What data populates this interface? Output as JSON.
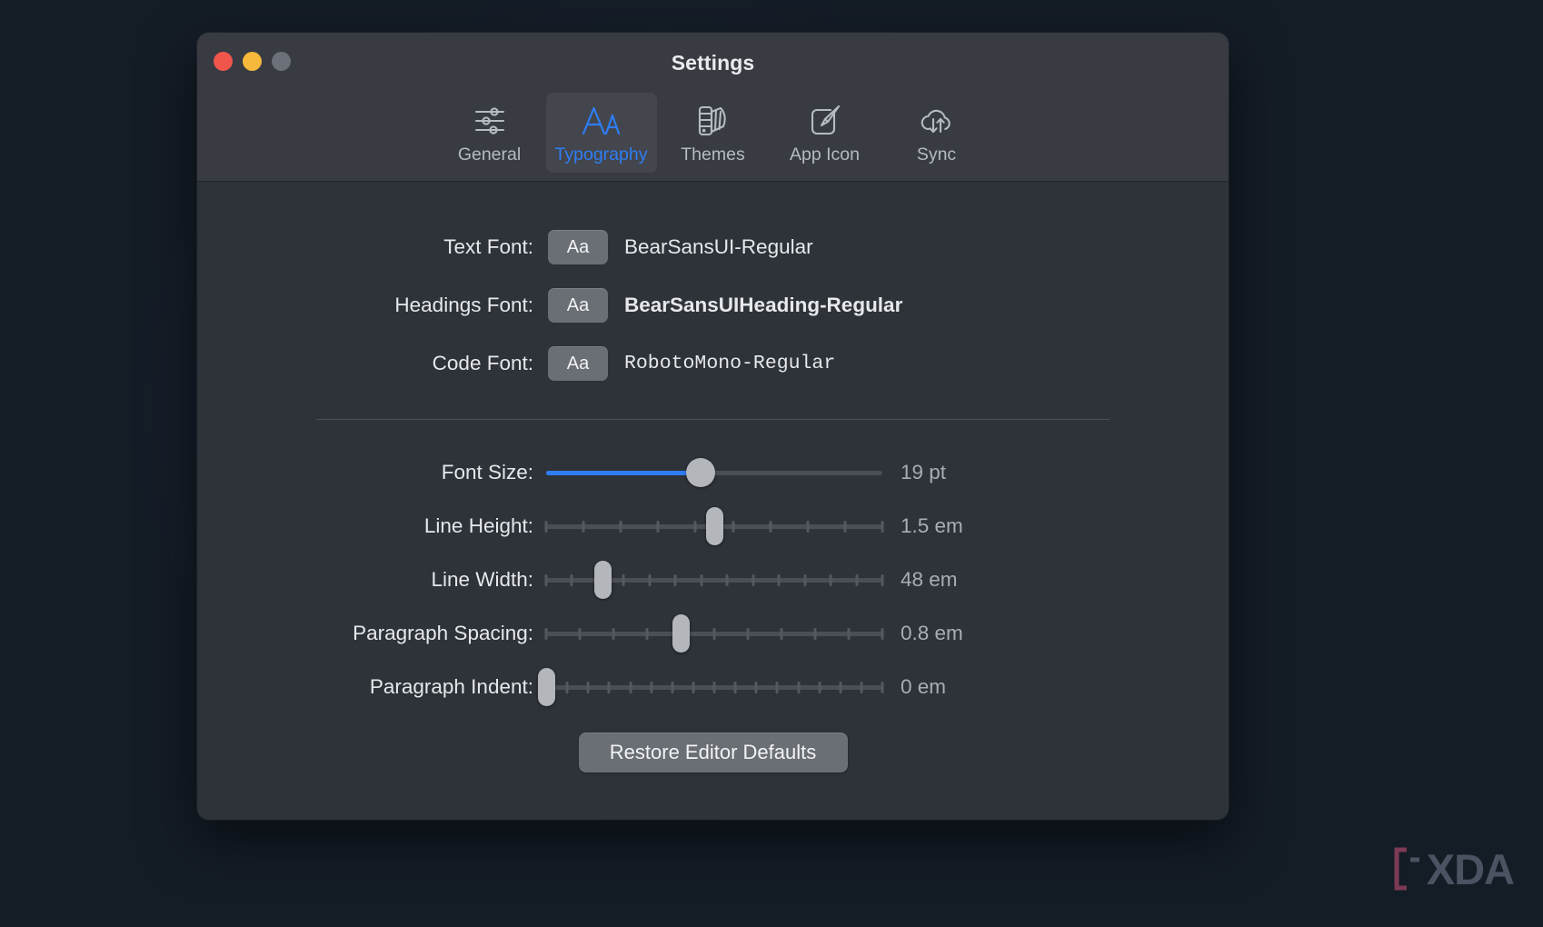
{
  "window": {
    "title": "Settings",
    "traffic_lights": [
      {
        "name": "close",
        "color": "#f1564c"
      },
      {
        "name": "minimize",
        "color": "#f6b93b"
      },
      {
        "name": "maximize",
        "color": "#6c7078"
      }
    ]
  },
  "toolbar": {
    "active": "Typography",
    "accent": "#2e7df6",
    "items": [
      {
        "label": "General",
        "icon": "sliders-icon",
        "active": false
      },
      {
        "label": "Typography",
        "icon": "font-size-icon",
        "active": true
      },
      {
        "label": "Themes",
        "icon": "swatch-fan-icon",
        "active": false
      },
      {
        "label": "App Icon",
        "icon": "paintbrush-icon",
        "active": false
      },
      {
        "label": "Sync",
        "icon": "cloud-sync-icon",
        "active": false
      }
    ]
  },
  "fonts": {
    "button_label": "Aa",
    "rows": [
      {
        "label": "Text Font:",
        "value": "BearSansUI-Regular",
        "style": "regular"
      },
      {
        "label": "Headings Font:",
        "value": "BearSansUIHeading-Regular",
        "style": "bold"
      },
      {
        "label": "Code Font:",
        "value": "RobotoMono-Regular",
        "style": "mono"
      }
    ]
  },
  "sliders": [
    {
      "label": "Font Size:",
      "value_text": "19 pt",
      "value": 19,
      "unit": "pt",
      "kind": "continuous",
      "percent": 46,
      "ticks": 0,
      "filled": true,
      "fill_color": "#2e7df6"
    },
    {
      "label": "Line Height:",
      "value_text": "1.5 em",
      "value": 1.5,
      "unit": "em",
      "kind": "ticked",
      "percent": 50,
      "ticks": 10,
      "filled": false
    },
    {
      "label": "Line Width:",
      "value_text": "48 em",
      "value": 48,
      "unit": "em",
      "kind": "ticked",
      "percent": 17,
      "ticks": 14,
      "filled": false
    },
    {
      "label": "Paragraph Spacing:",
      "value_text": "0.8 em",
      "value": 0.8,
      "unit": "em",
      "kind": "ticked",
      "percent": 40,
      "ticks": 11,
      "filled": false
    },
    {
      "label": "Paragraph Indent:",
      "value_text": "0 em",
      "value": 0,
      "unit": "em",
      "kind": "ticked",
      "percent": 0,
      "ticks": 17,
      "filled": false
    }
  ],
  "actions": {
    "restore_label": "Restore Editor Defaults"
  },
  "watermark": {
    "text": "XDA"
  }
}
